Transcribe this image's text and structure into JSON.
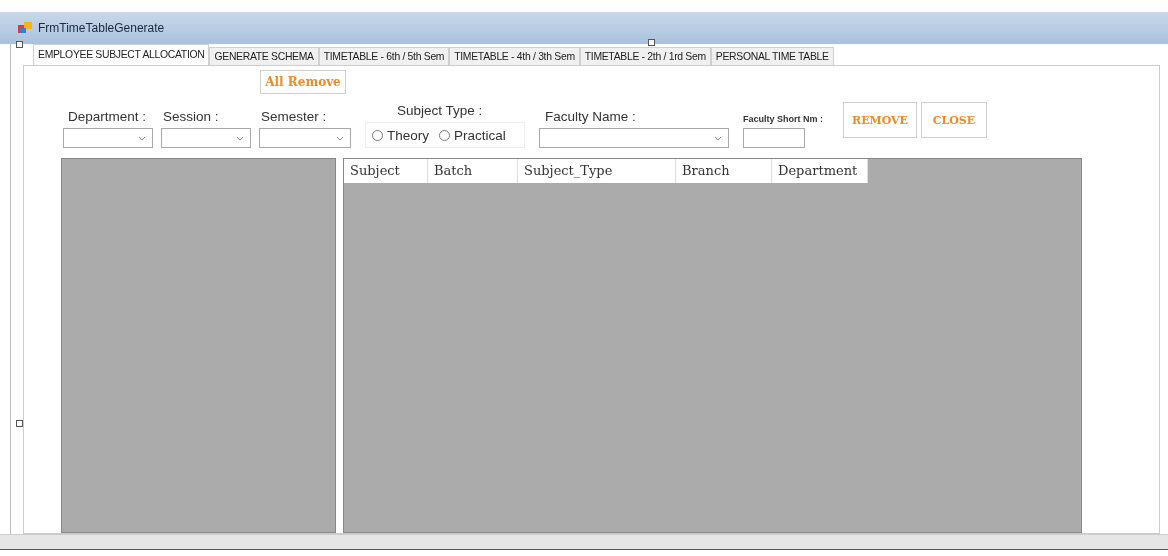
{
  "window": {
    "title": "FrmTimeTableGenerate"
  },
  "tabs": [
    {
      "label": "EMPLOYEE SUBJECT ALLOCATION",
      "selected": true
    },
    {
      "label": "GENERATE SCHEMA",
      "selected": false
    },
    {
      "label": "TIMETABLE - 6th / 5th Sem",
      "selected": false
    },
    {
      "label": "TIMETABLE - 4th / 3th Sem",
      "selected": false
    },
    {
      "label": "TIMETABLE - 2th / 1rd Sem",
      "selected": false
    },
    {
      "label": "PERSONAL TIME TABLE",
      "selected": false
    }
  ],
  "all_remove_button": "All Remove",
  "filters": [
    {
      "label": "Department :"
    },
    {
      "label": "Session :"
    },
    {
      "label": "Semester :"
    }
  ],
  "subject_type": {
    "label": "Subject Type :",
    "options": [
      {
        "label": "Theory",
        "selected": false
      },
      {
        "label": "Practical",
        "selected": false
      }
    ]
  },
  "faculty_name": {
    "label": "Faculty Name :"
  },
  "faculty_short": {
    "label": "Faculty Short Nm :"
  },
  "buttons": [
    "REMOVE",
    "CLOSE"
  ],
  "grid": {
    "columns": [
      "Subject",
      "Batch",
      "Subject_Type",
      "Branch",
      "Department"
    ]
  }
}
